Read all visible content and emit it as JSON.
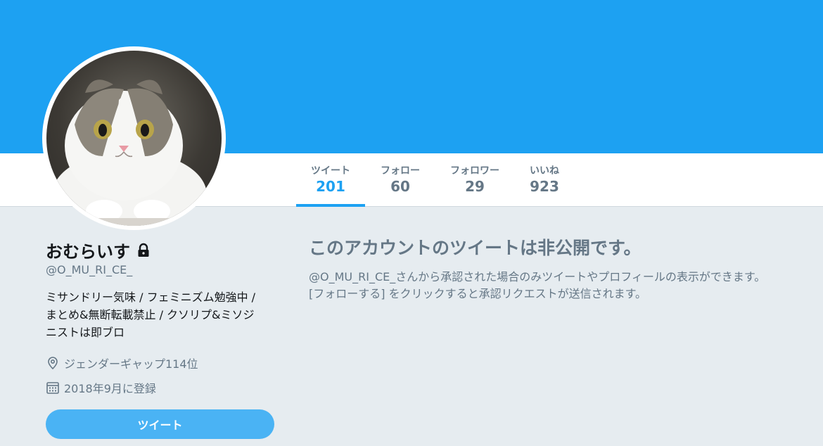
{
  "profile": {
    "display_name": "おむらいす",
    "handle": "@O_MU_RI_CE_",
    "bio_lines": [
      "ミサンドリー気味 / フェミニズム勉強中 /",
      "まとめ&無断転載禁止 / クソリプ&ミソジ",
      "ニストは即ブロ"
    ],
    "location": "ジェンダーギャップ114位",
    "joined": "2018年9月に登録",
    "tweet_button_label": "ツイート"
  },
  "stats": [
    {
      "label": "ツイート",
      "value": "201",
      "active": true
    },
    {
      "label": "フォロー",
      "value": "60",
      "active": false
    },
    {
      "label": "フォロワー",
      "value": "29",
      "active": false
    },
    {
      "label": "いいね",
      "value": "923",
      "active": false
    }
  ],
  "protected_notice": {
    "title": "このアカウントのツイートは非公開です。",
    "lines": [
      "@O_MU_RI_CE_さんから承認された場合のみツイートやプロフィールの表示ができます。",
      "[フォローする] をクリックすると承認リクエストが送信されます。"
    ]
  },
  "colors": {
    "banner": "#1da1f2",
    "accent": "#1da1f2",
    "tweet_button": "#4ab3f4",
    "page_background": "#e6ecf0",
    "muted_text": "#657786"
  },
  "icons": {
    "lock": "lock-icon",
    "location": "location-pin-icon",
    "calendar": "calendar-icon"
  }
}
